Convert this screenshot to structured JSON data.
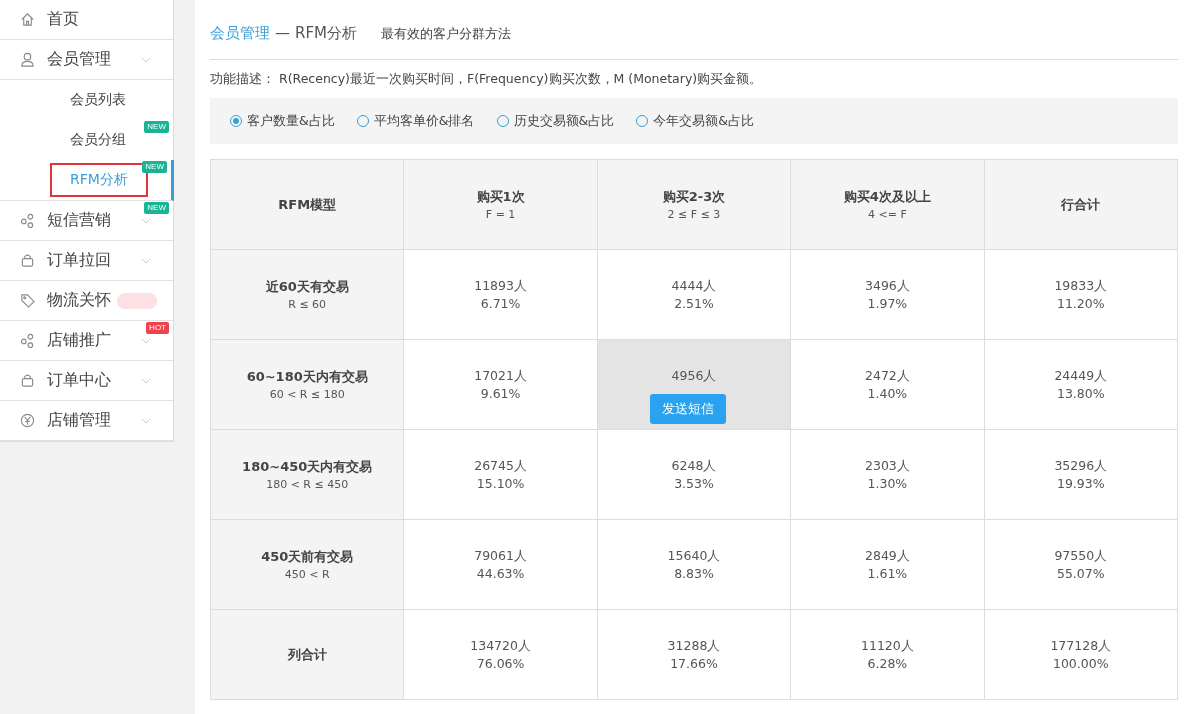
{
  "sidebar": {
    "items": [
      {
        "label": "首页",
        "kind": "link"
      },
      {
        "label": "会员管理",
        "kind": "menu",
        "children": [
          {
            "label": "会员列表",
            "selected": false
          },
          {
            "label": "会员分组",
            "selected": false,
            "badge": {
              "text": "NEW",
              "color": "#1ab394"
            }
          },
          {
            "label": "RFM分析",
            "selected": true,
            "badge": {
              "text": "NEW",
              "color": "#1ab394"
            }
          }
        ]
      },
      {
        "label": "短信营销",
        "kind": "menu",
        "badge": {
          "text": "NEW",
          "color": "#1ab394"
        }
      },
      {
        "label": "订单拉回",
        "kind": "menu"
      },
      {
        "label": "物流关怀",
        "kind": "link",
        "badge": {
          "color": "#fde0e3"
        }
      },
      {
        "label": "店铺推广",
        "kind": "menu",
        "badge": {
          "text": "HOT",
          "color": "#f0414f"
        }
      },
      {
        "label": "订单中心",
        "kind": "menu"
      },
      {
        "label": "店铺管理",
        "kind": "menu"
      }
    ]
  },
  "header": {
    "section": "会员管理",
    "separator": "—",
    "page": "RFM分析",
    "subtitle": "最有效的客户分群方法"
  },
  "description": "功能描述： R(Recency)最近一次购买时间，F(Frequency)购买次数，M (Monetary)购买金额。",
  "options": [
    {
      "label": "客户数量&占比",
      "selected": true
    },
    {
      "label": "平均客单价&排名",
      "selected": false
    },
    {
      "label": "历史交易额&占比",
      "selected": false
    },
    {
      "label": "今年交易额&占比",
      "selected": false
    }
  ],
  "table": {
    "columns": [
      {
        "title": "RFM模型"
      },
      {
        "title": "购买1次",
        "sub": "F = 1"
      },
      {
        "title": "购买2-3次",
        "sub": "2 ≤ F ≤ 3"
      },
      {
        "title": "购买4次及以上",
        "sub": "4 <= F"
      },
      {
        "title": "行合计"
      }
    ],
    "rows": [
      {
        "cells": [
          {
            "label": "近60天有交易",
            "sub": "R ≤ 60"
          },
          {
            "count": "11893人",
            "pct": "6.71%"
          },
          {
            "count": "4444人",
            "pct": "2.51%"
          },
          {
            "count": "3496人",
            "pct": "1.97%"
          },
          {
            "count": "19833人",
            "pct": "11.20%"
          }
        ]
      },
      {
        "cells": [
          {
            "label": "60~180天内有交易",
            "sub": "60 < R ≤ 180"
          },
          {
            "count": "17021人",
            "pct": "9.61%"
          },
          {
            "count": "4956人",
            "hovered": true,
            "action": "发送短信"
          },
          {
            "count": "2472人",
            "pct": "1.40%"
          },
          {
            "count": "24449人",
            "pct": "13.80%"
          }
        ]
      },
      {
        "cells": [
          {
            "label": "180~450天内有交易",
            "sub": "180 < R ≤ 450"
          },
          {
            "count": "26745人",
            "pct": "15.10%"
          },
          {
            "count": "6248人",
            "pct": "3.53%"
          },
          {
            "count": "2303人",
            "pct": "1.30%"
          },
          {
            "count": "35296人",
            "pct": "19.93%"
          }
        ]
      },
      {
        "cells": [
          {
            "label": "450天前有交易",
            "sub": "450 < R"
          },
          {
            "count": "79061人",
            "pct": "44.63%"
          },
          {
            "count": "15640人",
            "pct": "8.83%"
          },
          {
            "count": "2849人",
            "pct": "1.61%"
          },
          {
            "count": "97550人",
            "pct": "55.07%"
          }
        ]
      },
      {
        "cells": [
          {
            "label": "列合计"
          },
          {
            "count": "134720人",
            "pct": "76.06%"
          },
          {
            "count": "31288人",
            "pct": "17.66%"
          },
          {
            "count": "11120人",
            "pct": "6.28%"
          },
          {
            "count": "177128人",
            "pct": "100.00%"
          }
        ]
      }
    ]
  }
}
